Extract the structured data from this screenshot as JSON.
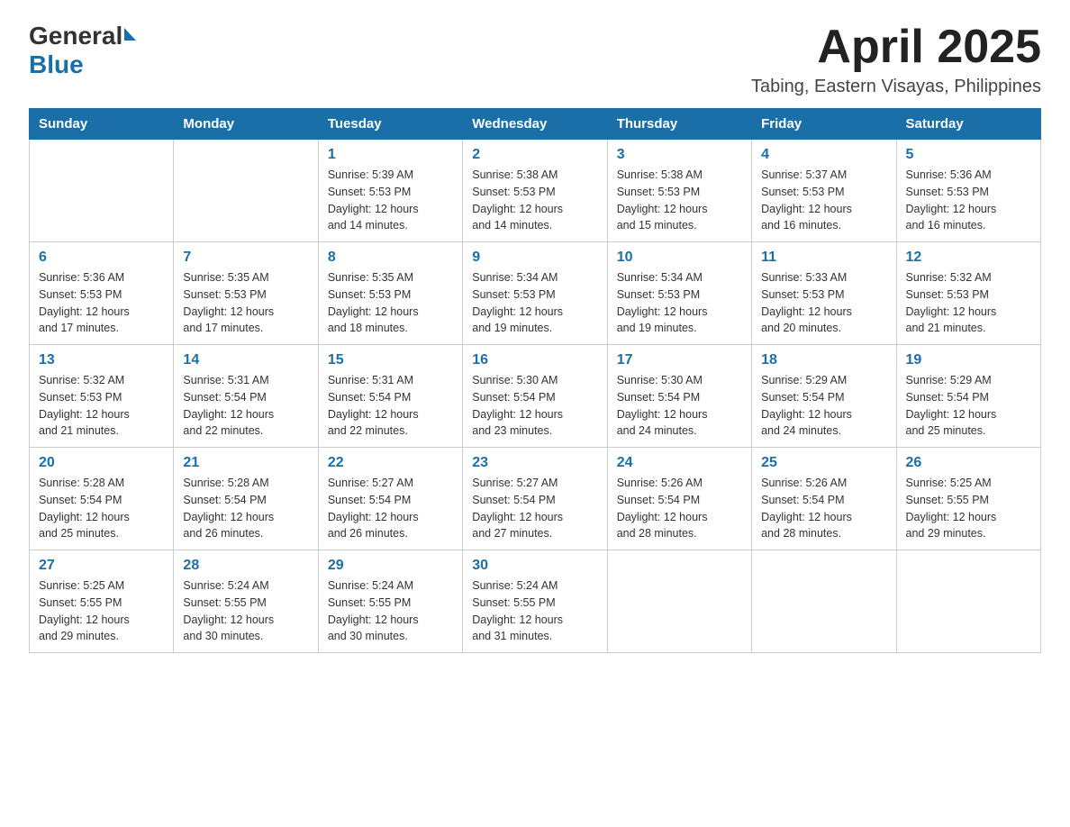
{
  "header": {
    "title": "April 2025",
    "subtitle": "Tabing, Eastern Visayas, Philippines"
  },
  "logo": {
    "general": "General",
    "blue": "Blue"
  },
  "columns": [
    "Sunday",
    "Monday",
    "Tuesday",
    "Wednesday",
    "Thursday",
    "Friday",
    "Saturday"
  ],
  "weeks": [
    [
      {
        "day": "",
        "detail": ""
      },
      {
        "day": "",
        "detail": ""
      },
      {
        "day": "1",
        "detail": "Sunrise: 5:39 AM\nSunset: 5:53 PM\nDaylight: 12 hours\nand 14 minutes."
      },
      {
        "day": "2",
        "detail": "Sunrise: 5:38 AM\nSunset: 5:53 PM\nDaylight: 12 hours\nand 14 minutes."
      },
      {
        "day": "3",
        "detail": "Sunrise: 5:38 AM\nSunset: 5:53 PM\nDaylight: 12 hours\nand 15 minutes."
      },
      {
        "day": "4",
        "detail": "Sunrise: 5:37 AM\nSunset: 5:53 PM\nDaylight: 12 hours\nand 16 minutes."
      },
      {
        "day": "5",
        "detail": "Sunrise: 5:36 AM\nSunset: 5:53 PM\nDaylight: 12 hours\nand 16 minutes."
      }
    ],
    [
      {
        "day": "6",
        "detail": "Sunrise: 5:36 AM\nSunset: 5:53 PM\nDaylight: 12 hours\nand 17 minutes."
      },
      {
        "day": "7",
        "detail": "Sunrise: 5:35 AM\nSunset: 5:53 PM\nDaylight: 12 hours\nand 17 minutes."
      },
      {
        "day": "8",
        "detail": "Sunrise: 5:35 AM\nSunset: 5:53 PM\nDaylight: 12 hours\nand 18 minutes."
      },
      {
        "day": "9",
        "detail": "Sunrise: 5:34 AM\nSunset: 5:53 PM\nDaylight: 12 hours\nand 19 minutes."
      },
      {
        "day": "10",
        "detail": "Sunrise: 5:34 AM\nSunset: 5:53 PM\nDaylight: 12 hours\nand 19 minutes."
      },
      {
        "day": "11",
        "detail": "Sunrise: 5:33 AM\nSunset: 5:53 PM\nDaylight: 12 hours\nand 20 minutes."
      },
      {
        "day": "12",
        "detail": "Sunrise: 5:32 AM\nSunset: 5:53 PM\nDaylight: 12 hours\nand 21 minutes."
      }
    ],
    [
      {
        "day": "13",
        "detail": "Sunrise: 5:32 AM\nSunset: 5:53 PM\nDaylight: 12 hours\nand 21 minutes."
      },
      {
        "day": "14",
        "detail": "Sunrise: 5:31 AM\nSunset: 5:54 PM\nDaylight: 12 hours\nand 22 minutes."
      },
      {
        "day": "15",
        "detail": "Sunrise: 5:31 AM\nSunset: 5:54 PM\nDaylight: 12 hours\nand 22 minutes."
      },
      {
        "day": "16",
        "detail": "Sunrise: 5:30 AM\nSunset: 5:54 PM\nDaylight: 12 hours\nand 23 minutes."
      },
      {
        "day": "17",
        "detail": "Sunrise: 5:30 AM\nSunset: 5:54 PM\nDaylight: 12 hours\nand 24 minutes."
      },
      {
        "day": "18",
        "detail": "Sunrise: 5:29 AM\nSunset: 5:54 PM\nDaylight: 12 hours\nand 24 minutes."
      },
      {
        "day": "19",
        "detail": "Sunrise: 5:29 AM\nSunset: 5:54 PM\nDaylight: 12 hours\nand 25 minutes."
      }
    ],
    [
      {
        "day": "20",
        "detail": "Sunrise: 5:28 AM\nSunset: 5:54 PM\nDaylight: 12 hours\nand 25 minutes."
      },
      {
        "day": "21",
        "detail": "Sunrise: 5:28 AM\nSunset: 5:54 PM\nDaylight: 12 hours\nand 26 minutes."
      },
      {
        "day": "22",
        "detail": "Sunrise: 5:27 AM\nSunset: 5:54 PM\nDaylight: 12 hours\nand 26 minutes."
      },
      {
        "day": "23",
        "detail": "Sunrise: 5:27 AM\nSunset: 5:54 PM\nDaylight: 12 hours\nand 27 minutes."
      },
      {
        "day": "24",
        "detail": "Sunrise: 5:26 AM\nSunset: 5:54 PM\nDaylight: 12 hours\nand 28 minutes."
      },
      {
        "day": "25",
        "detail": "Sunrise: 5:26 AM\nSunset: 5:54 PM\nDaylight: 12 hours\nand 28 minutes."
      },
      {
        "day": "26",
        "detail": "Sunrise: 5:25 AM\nSunset: 5:55 PM\nDaylight: 12 hours\nand 29 minutes."
      }
    ],
    [
      {
        "day": "27",
        "detail": "Sunrise: 5:25 AM\nSunset: 5:55 PM\nDaylight: 12 hours\nand 29 minutes."
      },
      {
        "day": "28",
        "detail": "Sunrise: 5:24 AM\nSunset: 5:55 PM\nDaylight: 12 hours\nand 30 minutes."
      },
      {
        "day": "29",
        "detail": "Sunrise: 5:24 AM\nSunset: 5:55 PM\nDaylight: 12 hours\nand 30 minutes."
      },
      {
        "day": "30",
        "detail": "Sunrise: 5:24 AM\nSunset: 5:55 PM\nDaylight: 12 hours\nand 31 minutes."
      },
      {
        "day": "",
        "detail": ""
      },
      {
        "day": "",
        "detail": ""
      },
      {
        "day": "",
        "detail": ""
      }
    ]
  ]
}
